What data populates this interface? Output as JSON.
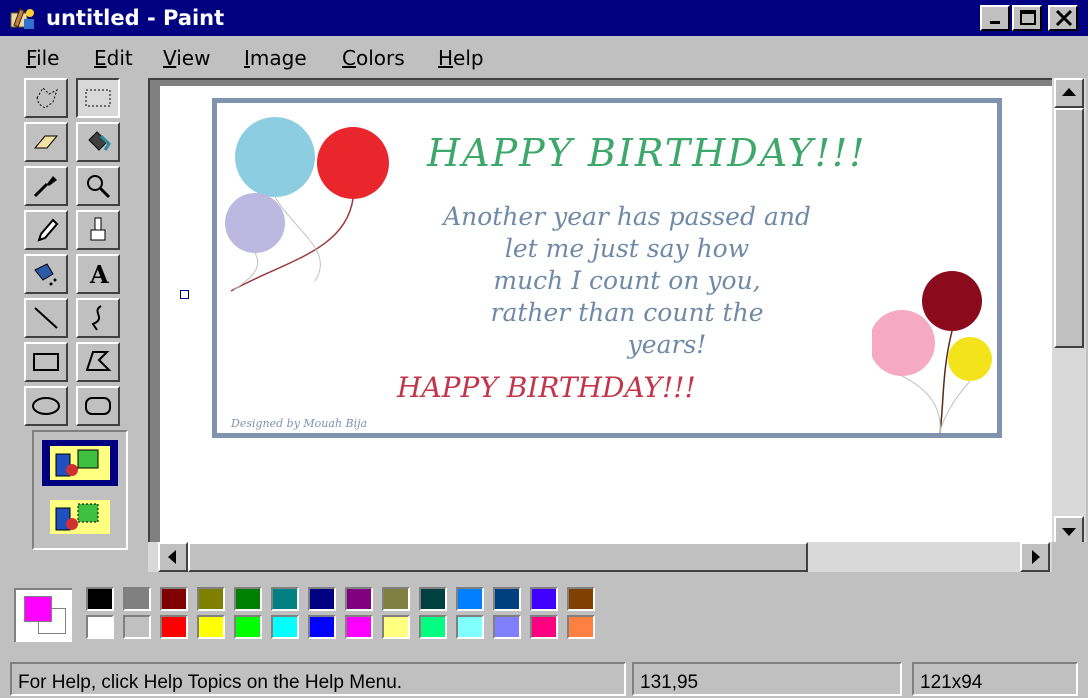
{
  "window": {
    "title": "untitled - Paint"
  },
  "menu": [
    {
      "pre": "",
      "key": "F",
      "post": "ile"
    },
    {
      "pre": "",
      "key": "E",
      "post": "dit"
    },
    {
      "pre": "",
      "key": "V",
      "post": "iew"
    },
    {
      "pre": "",
      "key": "I",
      "post": "mage"
    },
    {
      "pre": "",
      "key": "C",
      "post": "olors"
    },
    {
      "pre": "",
      "key": "H",
      "post": "elp"
    }
  ],
  "tools": [
    "free-form-select",
    "select",
    "eraser",
    "fill-with-color",
    "pick-color",
    "magnifier",
    "pencil",
    "brush",
    "airbrush",
    "text",
    "line",
    "curve",
    "rectangle",
    "polygon",
    "ellipse",
    "rounded-rectangle"
  ],
  "selected_tool": "select",
  "card": {
    "heading": "HAPPY BIRTHDAY!!!",
    "message_lines": [
      "Another year has passed and",
      "let me just say how",
      "much I count on you,",
      "rather than count the",
      "years!"
    ],
    "closing": "HAPPY BIRTHDAY!!!",
    "credit": "Designed by Mouah Bija"
  },
  "palette": {
    "foreground": "#ff00ff",
    "background": "#ffffff",
    "top_row": [
      "#000000",
      "#808080",
      "#800000",
      "#808000",
      "#008000",
      "#008080",
      "#000080",
      "#800080",
      "#808040",
      "#004040",
      "#0080ff",
      "#004080",
      "#4000ff",
      "#804000"
    ],
    "bottom_row": [
      "#ffffff",
      "#c0c0c0",
      "#ff0000",
      "#ffff00",
      "#00ff00",
      "#00ffff",
      "#0000ff",
      "#ff00ff",
      "#ffff80",
      "#00ff80",
      "#80ffff",
      "#8080ff",
      "#ff0080",
      "#ff8040"
    ]
  },
  "status": {
    "help": "For Help, click Help Topics on the Help Menu.",
    "coords": "131,95",
    "size": "121x94"
  }
}
